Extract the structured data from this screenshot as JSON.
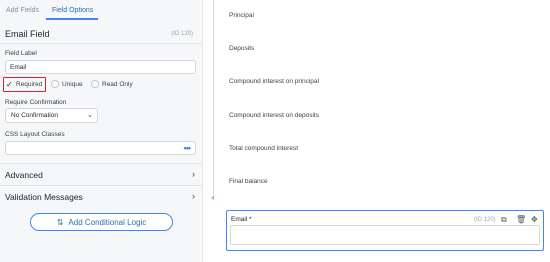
{
  "tabs": [
    {
      "label": "Add Fields",
      "active": false
    },
    {
      "label": "Field Options",
      "active": true
    }
  ],
  "field": {
    "title": "Email Field",
    "id": "(ID 120)"
  },
  "options": {
    "field_label_title": "Field Label",
    "field_label_value": "Email",
    "required_label": "Required",
    "required_checked": true,
    "unique_label": "Unique",
    "unique_checked": false,
    "readonly_label": "Read Only",
    "readonly_checked": false,
    "require_confirmation_title": "Require Confirmation",
    "require_confirmation_value": "No Confirmation",
    "css_classes_title": "CSS Layout Classes",
    "css_classes_value": "",
    "css_more": "•••"
  },
  "sections": [
    {
      "label": "Advanced"
    },
    {
      "label": "Validation Messages"
    }
  ],
  "conditional_button": {
    "icon": "⇅",
    "label": "Add Conditional Logic"
  },
  "form_rows": [
    {
      "label": "Principal"
    },
    {
      "label": "Deposits"
    },
    {
      "label": "Compound interest on principal"
    },
    {
      "label": "Compound interest on deposits"
    },
    {
      "label": "Total compound interest"
    },
    {
      "label": "Final balance"
    }
  ],
  "email_preview": {
    "label": "Email *",
    "id": "(ID 120)",
    "icons": [
      "duplicate-icon",
      "trash-icon",
      "move-icon"
    ]
  },
  "colors": {
    "accent": "#4285f4",
    "required_highlight": "#e0202f"
  }
}
